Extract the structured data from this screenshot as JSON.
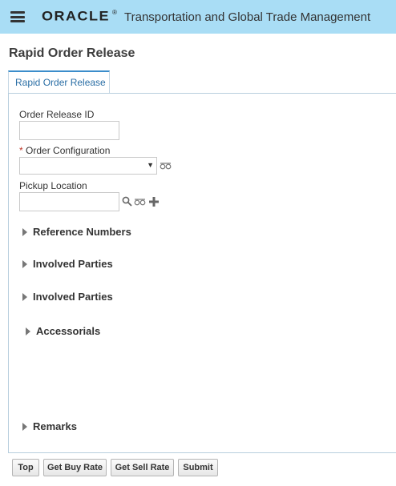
{
  "header": {
    "logo_text": "ORACLE",
    "logo_mark": "®",
    "app_title": "Transportation and Global Trade Management"
  },
  "page": {
    "title": "Rapid Order Release"
  },
  "tabs": [
    {
      "label": "Rapid Order Release",
      "selected": true
    }
  ],
  "form": {
    "order_release_id": {
      "label": "Order Release ID",
      "value": ""
    },
    "order_configuration": {
      "required_marker": "*",
      "label": "Order Configuration",
      "value": ""
    },
    "pickup_location": {
      "label": "Pickup Location",
      "value": ""
    }
  },
  "sections": {
    "reference_numbers": "Reference Numbers",
    "involved_parties_1": "Involved Parties",
    "involved_parties_2": "Involved Parties",
    "accessorials": "Accessorials",
    "remarks": "Remarks"
  },
  "buttons": {
    "top": "Top",
    "get_buy_rate": "Get Buy Rate",
    "get_sell_rate": "Get Sell Rate",
    "submit": "Submit"
  },
  "icons": {
    "menu": "hamburger-menu-icon",
    "search": "magnifier-search-icon",
    "view": "glasses-view-icon",
    "add": "plus-add-icon",
    "expand": "triangle-right-icon"
  },
  "colors": {
    "header_bg": "#a9ddf5",
    "tab_accent": "#3b8dcb",
    "tab_text": "#2a6ea5",
    "required": "#c0392b"
  }
}
